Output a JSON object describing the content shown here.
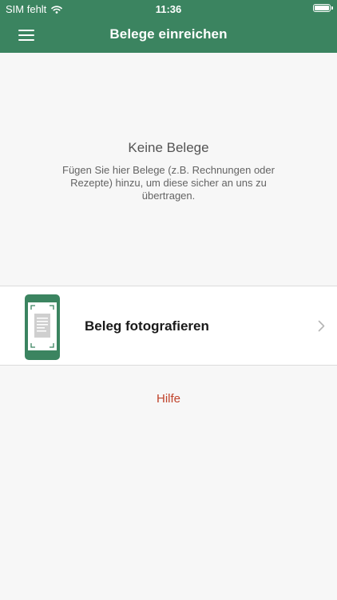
{
  "status_bar": {
    "carrier": "SIM fehlt",
    "time": "11:36",
    "battery_level": 1.0
  },
  "nav": {
    "title": "Belege einreichen",
    "menu_icon": "hamburger-menu-icon"
  },
  "empty_state": {
    "title": "Keine Belege",
    "description": "Fügen Sie hier Belege (z.B. Rechnungen oder Rezepte) hinzu, um diese sicher an uns zu übertragen."
  },
  "action": {
    "label": "Beleg fotografieren",
    "icon": "phone-camera-document-icon",
    "chevron_icon": "chevron-right-icon"
  },
  "help": {
    "label": "Hilfe"
  },
  "colors": {
    "header": "#3b8460",
    "background": "#f7f7f7",
    "help_link": "#c0432b"
  }
}
